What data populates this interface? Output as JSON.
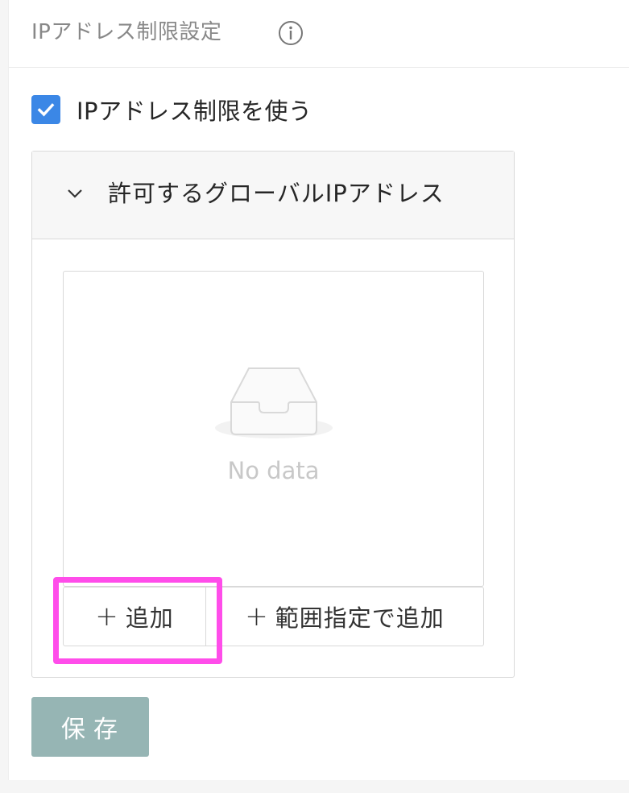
{
  "header": {
    "title": "IPアドレス制限設定",
    "info_icon": "info-circle-icon"
  },
  "restriction": {
    "checkbox_checked": true,
    "checkbox_label": "IPアドレス制限を使う"
  },
  "global_ip": {
    "title": "許可するグローバルIPアドレス",
    "expanded": true,
    "empty_text": "No data",
    "add_icon": "+",
    "add_label": "追加",
    "add_range_icon": "+",
    "add_range_label": "範囲指定で追加"
  },
  "save_label": "保存",
  "colors": {
    "checkbox": "#3b87e6",
    "save_button": "#96b5b4",
    "highlight": "#ff4dea"
  }
}
